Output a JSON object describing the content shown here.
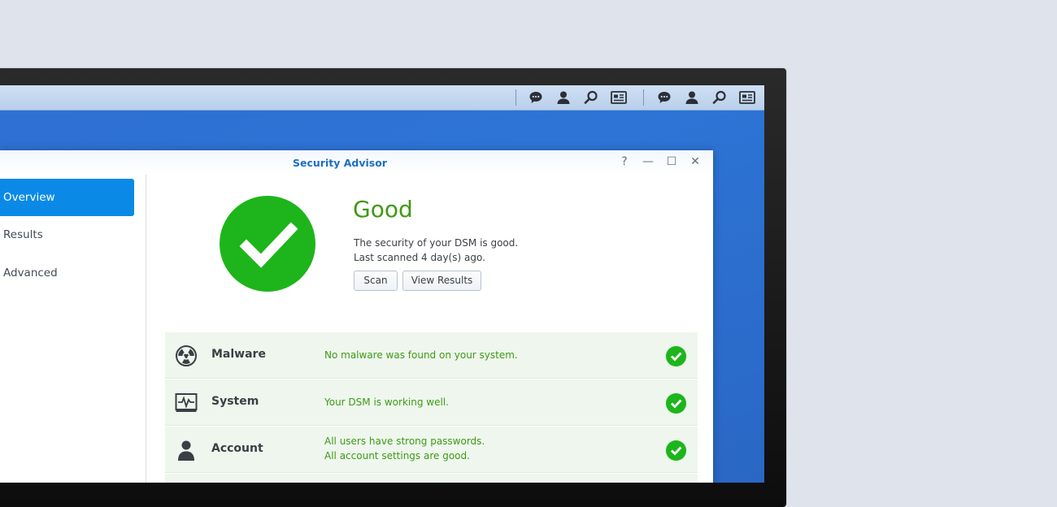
{
  "taskbar": {
    "icons_group_1": [
      "chat-icon",
      "user-icon",
      "search-icon",
      "widgets-icon"
    ],
    "icons_group_2": [
      "chat-icon",
      "user-icon",
      "search-icon",
      "widgets-icon"
    ]
  },
  "window": {
    "title": "Security Advisor",
    "controls": {
      "help": "?",
      "minimize": "—",
      "maximize": "☐",
      "close": "✕"
    }
  },
  "sidebar": {
    "items": [
      {
        "label": "Overview",
        "active": true
      },
      {
        "label": "Results",
        "active": false
      },
      {
        "label": "Advanced",
        "active": false
      }
    ]
  },
  "status": {
    "title": "Good",
    "line1": "The security of your DSM is good.",
    "line2": "Last scanned 4 day(s) ago.",
    "scan_label": "Scan",
    "view_results_label": "View Results",
    "icon": "check-icon",
    "color": "#1db51b"
  },
  "categories": [
    {
      "name": "Malware",
      "icon": "radiation-icon",
      "messages": [
        "No malware was found on your system."
      ],
      "status": "ok"
    },
    {
      "name": "System",
      "icon": "monitor-pulse-icon",
      "messages": [
        "Your DSM is working well."
      ],
      "status": "ok"
    },
    {
      "name": "Account",
      "icon": "person-icon",
      "messages": [
        "All users have strong passwords.",
        "All account settings are good."
      ],
      "status": "ok"
    }
  ],
  "colors": {
    "accent": "#0a8ae6",
    "good_green": "#1db51b",
    "text_green": "#3f9a14",
    "title_blue": "#1d6fbe"
  }
}
